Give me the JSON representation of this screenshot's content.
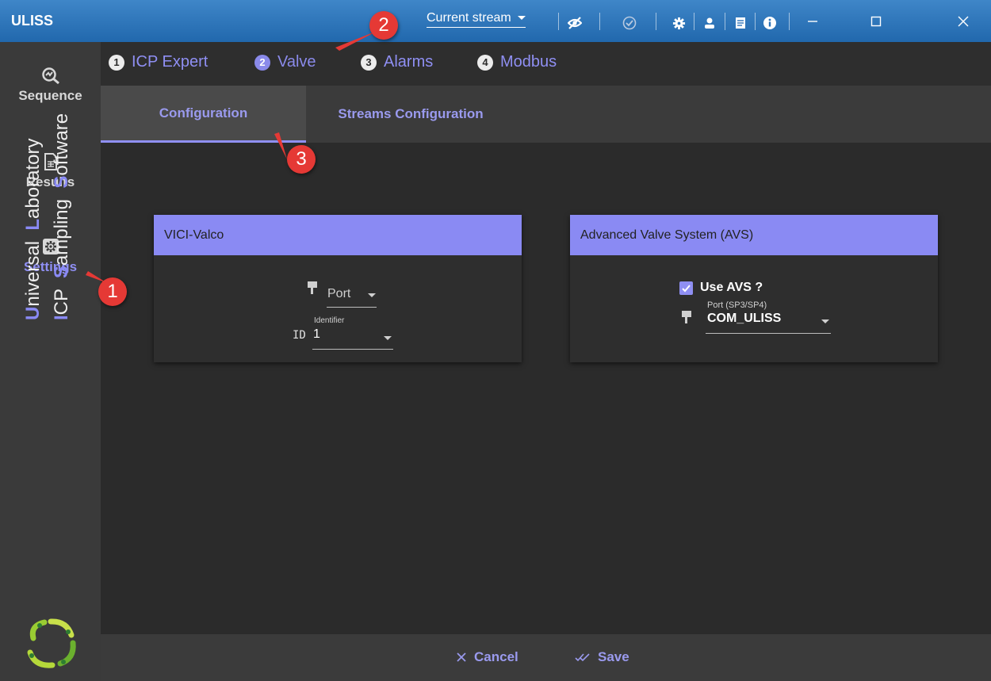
{
  "window": {
    "title": "ULISS",
    "stream_select": "Current stream",
    "icons": [
      "eye-off-icon",
      "check-circle-icon",
      "gear-icon",
      "user-icon",
      "document-icon",
      "info-icon",
      "minimize-icon",
      "maximize-icon",
      "close-icon"
    ]
  },
  "sidebar": {
    "items": [
      {
        "label": "Sequence",
        "icon": "sequence-icon"
      },
      {
        "label": "Results",
        "icon": "document-icon"
      },
      {
        "label": "Settings",
        "icon": "gear-icon",
        "active": true
      }
    ],
    "brand_line1": {
      "u": "U",
      "rest1": "niversal ",
      "l": "L",
      "rest2": "aboratory"
    },
    "brand_line2": {
      "i": "I",
      "rest1": "CP ",
      "s1": "S",
      "rest2": "ampling ",
      "s2": "S",
      "rest3": "oftware"
    }
  },
  "steps": [
    {
      "num": "1",
      "label": "ICP Expert"
    },
    {
      "num": "2",
      "label": "Valve",
      "current": true
    },
    {
      "num": "3",
      "label": "Alarms"
    },
    {
      "num": "4",
      "label": "Modbus"
    }
  ],
  "tabs": [
    {
      "label": "Configuration",
      "active": true
    },
    {
      "label": "Streams Configuration"
    }
  ],
  "cards": {
    "vici": {
      "title": "VICI-Valco",
      "port_placeholder": "Port",
      "id_prefix": "ID",
      "identifier_label": "Identifier",
      "identifier_value": "1"
    },
    "avs": {
      "title": "Advanced Valve System (AVS)",
      "use_avs_label": "Use AVS ?",
      "use_avs_checked": true,
      "port_label": "Port (SP3/SP4)",
      "port_value": "COM_ULISS"
    }
  },
  "footer": {
    "cancel_label": "Cancel",
    "save_label": "Save"
  },
  "callouts": [
    "1",
    "2",
    "3"
  ],
  "colors": {
    "accent": "#8a8af3",
    "titlebar": "#2a72b8",
    "callout": "#e53935"
  }
}
